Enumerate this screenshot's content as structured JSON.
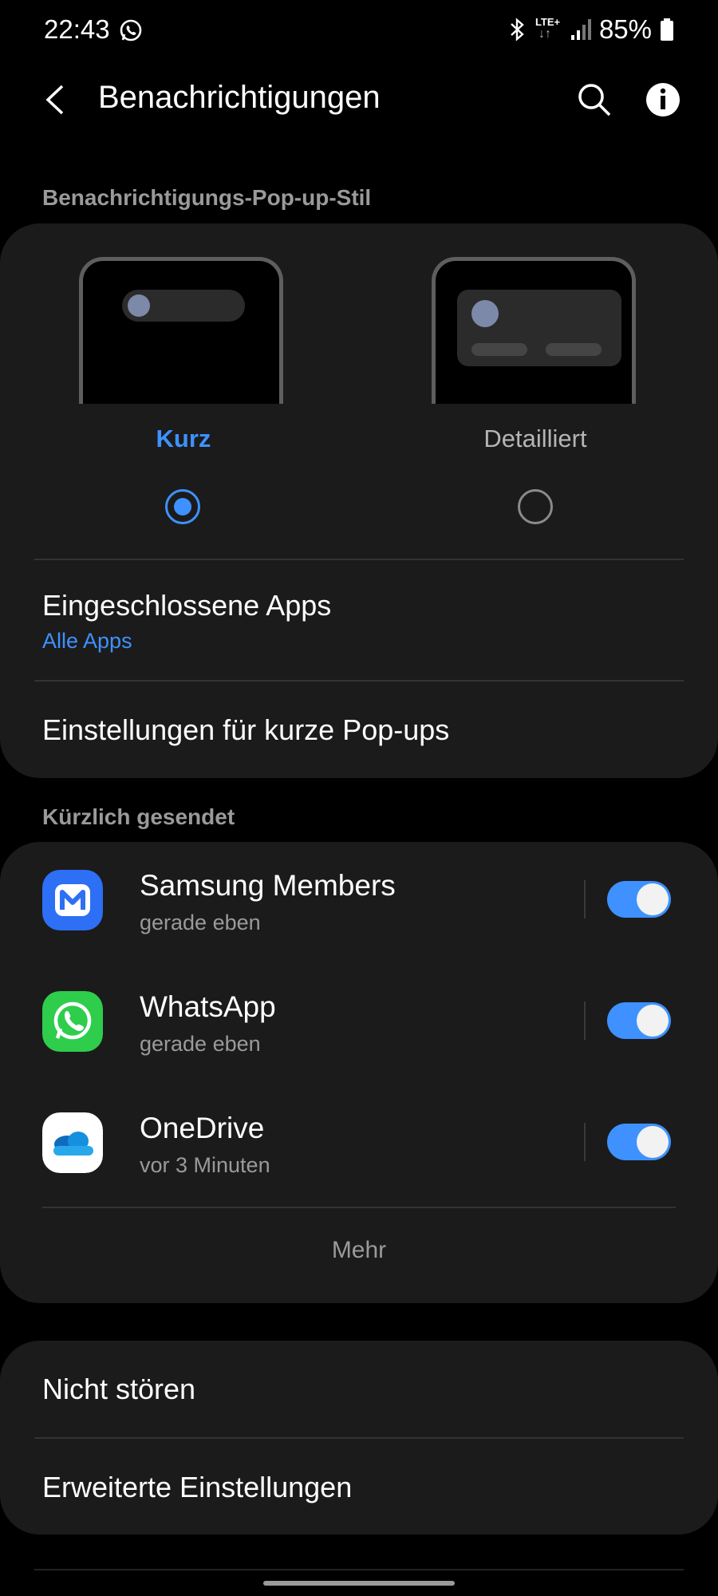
{
  "status_bar": {
    "time": "22:43",
    "network": "LTE+",
    "battery": "85%"
  },
  "header": {
    "title": "Benachrichtigungen",
    "icons": [
      "back-icon",
      "search-icon",
      "info-icon"
    ]
  },
  "popup_style": {
    "section_label": "Benachrichtigungs-Pop-up-Stil",
    "options": [
      {
        "label": "Kurz",
        "selected": true
      },
      {
        "label": "Detailliert",
        "selected": false
      }
    ],
    "included_apps": {
      "title": "Eingeschlossene Apps",
      "value": "Alle Apps"
    },
    "brief_settings": "Einstellungen für kurze Pop-ups"
  },
  "recent": {
    "section_label": "Kürzlich gesendet",
    "apps": [
      {
        "name": "Samsung Members",
        "time": "gerade eben",
        "enabled": true,
        "icon": "samsung-members-icon"
      },
      {
        "name": "WhatsApp",
        "time": "gerade eben",
        "enabled": true,
        "icon": "whatsapp-icon"
      },
      {
        "name": "OneDrive",
        "time": "vor 3 Minuten",
        "enabled": true,
        "icon": "onedrive-icon"
      }
    ],
    "more": "Mehr"
  },
  "bottom": {
    "dnd": "Nicht stören",
    "advanced": "Erweiterte Einstellungen"
  },
  "colors": {
    "accent": "#3e91ff",
    "background": "#000000",
    "card": "#1b1b1b"
  }
}
